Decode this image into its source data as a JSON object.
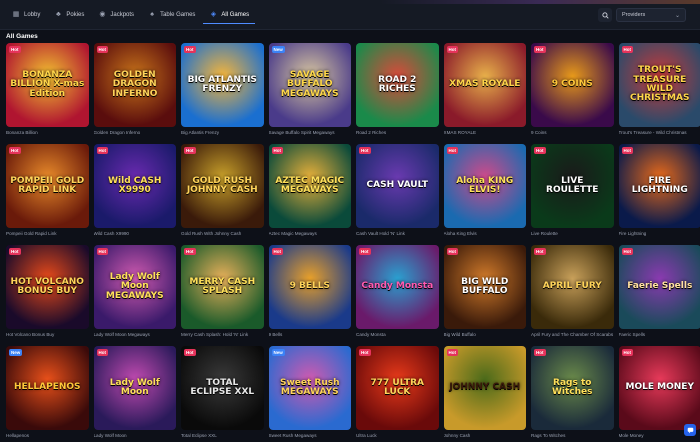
{
  "nav": {
    "tabs": [
      {
        "label": "Lobby",
        "icon": "lobby-icon"
      },
      {
        "label": "Pokies",
        "icon": "pokies-icon"
      },
      {
        "label": "Jackpots",
        "icon": "jackpots-icon"
      },
      {
        "label": "Table Games",
        "icon": "table-games-icon"
      },
      {
        "label": "All Games",
        "icon": "all-games-icon",
        "active": true
      }
    ],
    "providers_label": "Providers"
  },
  "section_title": "All Games",
  "rows": [
    [
      {
        "name": "Bonanza Billion",
        "logo": "BONANZA BILLION X-mas Edition",
        "badge": "Hot",
        "bg": [
          "#b01530",
          "#f2c230"
        ],
        "logo_color": "#ffd54a"
      },
      {
        "name": "Golden Dragon Inferno",
        "logo": "GOLDEN DRAGON INFERNO",
        "badge": "Hot",
        "bg": [
          "#5a0d0d",
          "#c8741a"
        ],
        "logo_color": "#ffd45a"
      },
      {
        "name": "Big Atlantis Frenzy",
        "logo": "BIG ATLANTIS FRENZY",
        "badge": "Hot",
        "bg": [
          "#1a6fd0",
          "#f6b53a"
        ],
        "logo_color": "#ffffff"
      },
      {
        "name": "Savage Buffalo Spirit Megaways",
        "logo": "SAVAGE BUFFALO MEGAWAYS",
        "badge": "New",
        "bg": [
          "#4a3b8a",
          "#d9c7a0"
        ],
        "logo_color": "#ffd84a"
      },
      {
        "name": "Road 2 Riches",
        "logo": "ROAD 2 RICHES",
        "badge": "",
        "bg": [
          "#1a8a4a",
          "#d94a3a"
        ],
        "logo_color": "#ffffff"
      },
      {
        "name": "XMAS ROYALE",
        "logo": "XMAS ROYALE",
        "badge": "Hot",
        "bg": [
          "#8a1a2a",
          "#e8b04a"
        ],
        "logo_color": "#ffd54a"
      },
      {
        "name": "9 Coins",
        "logo": "9 COINS",
        "badge": "Hot",
        "bg": [
          "#3a0a4a",
          "#e89a1a"
        ],
        "logo_color": "#ffc83a"
      },
      {
        "name": "Trout's Treasure - Wild Christmas",
        "logo": "TROUT'S TREASURE WILD CHRISTMAS",
        "badge": "Hot",
        "bg": [
          "#2a4a6a",
          "#c83a3a"
        ],
        "logo_color": "#ffd54a"
      }
    ],
    [
      {
        "name": "Pompeii Gold Rapid Link",
        "logo": "POMPEII GOLD RAPID LINK",
        "badge": "Hot",
        "bg": [
          "#6a1a0a",
          "#e88a2a"
        ],
        "logo_color": "#ffd45a"
      },
      {
        "name": "Wild Cash X9990",
        "logo": "Wild CASH X9990",
        "badge": "Hot",
        "bg": [
          "#1a1a6a",
          "#6a2ab0"
        ],
        "logo_color": "#ffe05a"
      },
      {
        "name": "Gold Rush With Johnny Cash",
        "logo": "GOLD RUSH JOHNNY CASH",
        "badge": "Hot",
        "bg": [
          "#3a1a0a",
          "#c8a02a"
        ],
        "logo_color": "#ffd45a"
      },
      {
        "name": "Aztec Magic Megaways",
        "logo": "AZTEC MAGIC MEGAWAYS",
        "badge": "Hot",
        "bg": [
          "#0a4a3a",
          "#e8b03a"
        ],
        "logo_color": "#ffe05a"
      },
      {
        "name": "Cash Vault Hold 'N' Link",
        "logo": "CASH VAULT",
        "badge": "Hot",
        "bg": [
          "#1a2a6a",
          "#6a3ab0"
        ],
        "logo_color": "#ffffff"
      },
      {
        "name": "Aloha King Elvis",
        "logo": "Aloha KING ELVIS!",
        "badge": "Hot",
        "bg": [
          "#1a6ab0",
          "#d04a8a"
        ],
        "logo_color": "#ffe05a"
      },
      {
        "name": "Live Roulette",
        "logo": "LIVE ROULETTE",
        "badge": "Hot",
        "bg": [
          "#0a3a1a",
          "#1a1a1a"
        ],
        "logo_color": "#ffffff"
      },
      {
        "name": "Fire Lightning",
        "logo": "FIRE LIGHTNING",
        "badge": "Hot",
        "bg": [
          "#0a1a4a",
          "#e86a1a"
        ],
        "logo_color": "#ffffff"
      }
    ],
    [
      {
        "name": "Hot Volcano Bonus Buy",
        "logo": "HOT VOLCANO BONUS BUY",
        "badge": "Hot",
        "bg": [
          "#1a0a2a",
          "#e84a1a"
        ],
        "logo_color": "#ffd45a"
      },
      {
        "name": "Lady Wolf Moon Megaways",
        "logo": "Lady Wolf Moon MEGAWAYS",
        "badge": "Hot",
        "bg": [
          "#3a1a6a",
          "#d05ab0"
        ],
        "logo_color": "#ffe05a"
      },
      {
        "name": "Merry Cash Splash: Hold 'N' Link",
        "logo": "MERRY CASH SPLASH",
        "badge": "Hot",
        "bg": [
          "#1a5a2a",
          "#e8b05a"
        ],
        "logo_color": "#ffe05a"
      },
      {
        "name": "9 Bells",
        "logo": "9 BELLS",
        "badge": "Hot",
        "bg": [
          "#1a3a8a",
          "#e8a02a"
        ],
        "logo_color": "#ffd45a"
      },
      {
        "name": "Candy Monsta",
        "logo": "Candy Monsta",
        "badge": "Hot",
        "bg": [
          "#6a1a6a",
          "#2aa0d0"
        ],
        "logo_color": "#ff5ab0"
      },
      {
        "name": "Big Wild Buffalo",
        "logo": "BIG WILD BUFFALO",
        "badge": "Hot",
        "bg": [
          "#3a1a0a",
          "#d07a2a"
        ],
        "logo_color": "#ffffff"
      },
      {
        "name": "April Fury and The Chamber Of Scarabs",
        "logo": "APRIL FURY",
        "badge": "Hot",
        "bg": [
          "#3a2a0a",
          "#c8a05a"
        ],
        "logo_color": "#ffd45a"
      },
      {
        "name": "Faeric Spells",
        "logo": "Faerie Spells",
        "badge": "Hot",
        "bg": [
          "#1a4a5a",
          "#8a3ab0"
        ],
        "logo_color": "#ffe0a0"
      }
    ],
    [
      {
        "name": "Hellapenos",
        "logo": "HELLAPENOS",
        "badge": "New",
        "bg": [
          "#3a0a0a",
          "#e8501a"
        ],
        "logo_color": "#ffc83a"
      },
      {
        "name": "Lady Wolf Moon",
        "logo": "Lady Wolf Moon",
        "badge": "Hot",
        "bg": [
          "#2a1a5a",
          "#c04ab0"
        ],
        "logo_color": "#ffe05a"
      },
      {
        "name": "Total Eclipse XXL",
        "logo": "TOTAL ECLIPSE XXL",
        "badge": "Hot",
        "bg": [
          "#0a0a0a",
          "#3a3a3a"
        ],
        "logo_color": "#e8e8e8"
      },
      {
        "name": "Sweet Rush Megaways",
        "logo": "Sweet Rush MEGAWAYS",
        "badge": "New",
        "bg": [
          "#2a6ad0",
          "#d05ab0"
        ],
        "logo_color": "#ffd45a"
      },
      {
        "name": "Ultra Luck",
        "logo": "777 ULTRA LUCK",
        "badge": "Hot",
        "bg": [
          "#6a0a0a",
          "#e83a1a"
        ],
        "logo_color": "#ffd45a"
      },
      {
        "name": "Johnny Cash",
        "logo": "JOHNNY CASH",
        "badge": "Hot",
        "bg": [
          "#c89a2a",
          "#4a6a1a"
        ],
        "logo_color": "#3a1a0a"
      },
      {
        "name": "Rags To Witches",
        "logo": "Rags to Witches",
        "badge": "Hot",
        "bg": [
          "#1a2a3a",
          "#6a8a4a"
        ],
        "logo_color": "#ffe05a"
      },
      {
        "name": "Mole Money",
        "logo": "MOLE MONEY",
        "badge": "Hot",
        "bg": [
          "#5a0a1a",
          "#e83a5a"
        ],
        "logo_color": "#ffffff"
      }
    ]
  ]
}
